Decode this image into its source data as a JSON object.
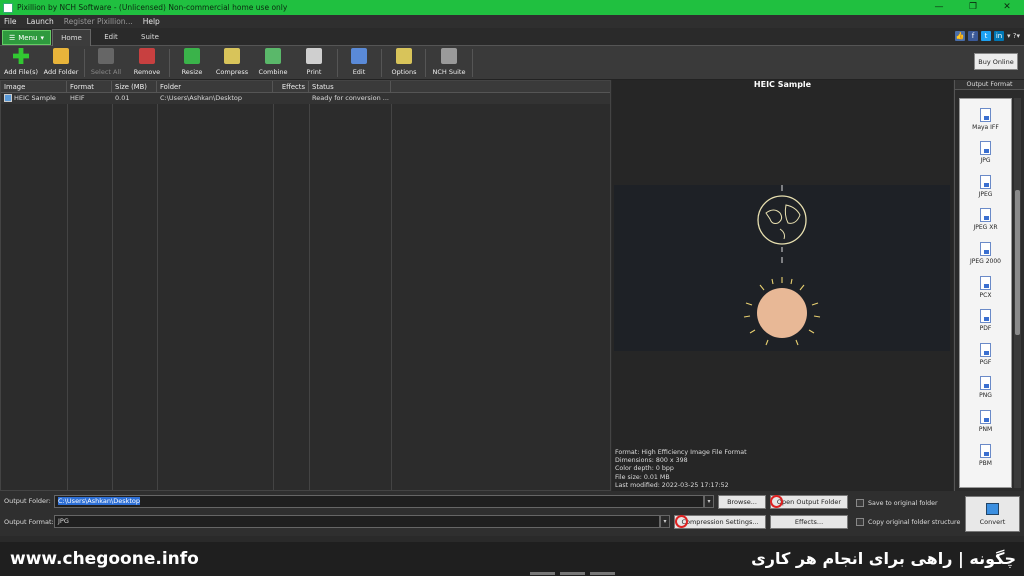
{
  "window": {
    "title": "Pixillion by NCH Software - (Unlicensed) Non-commercial home use only",
    "controls": [
      "—",
      "❐",
      "✕"
    ]
  },
  "menubar": {
    "items": [
      "File",
      "Launch",
      "Register Pixillion...",
      "Help"
    ]
  },
  "ribbon": {
    "menu_label": "Menu",
    "tabs": [
      "Home",
      "Edit",
      "Suite"
    ],
    "active_tab": "Home"
  },
  "toolbar": {
    "buttons": [
      {
        "label": "Add File(s)",
        "icon": "add-file-icon",
        "color": "#32c832"
      },
      {
        "label": "Add Folder",
        "icon": "add-folder-icon",
        "color": "#e8b43a"
      },
      {
        "label": "Select All",
        "icon": "select-all-icon",
        "color": "#777777",
        "disabled": true
      },
      {
        "label": "Remove",
        "icon": "remove-icon",
        "color": "#c84040"
      },
      {
        "label": "Resize",
        "icon": "resize-icon",
        "color": "#3ab34a"
      },
      {
        "label": "Compress",
        "icon": "compress-icon",
        "color": "#d8c45a"
      },
      {
        "label": "Combine",
        "icon": "combine-icon",
        "color": "#5ab86a"
      },
      {
        "label": "Print",
        "icon": "print-icon",
        "color": "#cfcfcf"
      },
      {
        "label": "Edit",
        "icon": "edit-icon",
        "color": "#5a8ad8"
      },
      {
        "label": "Options",
        "icon": "options-icon",
        "color": "#d8c45a"
      },
      {
        "label": "NCH Suite",
        "icon": "nch-suite-icon",
        "color": "#9a9a9a"
      }
    ],
    "buy_online": "Buy Online"
  },
  "file_list": {
    "columns": [
      "Image",
      "Format",
      "Size (MB)",
      "Folder",
      "Effects",
      "Status"
    ],
    "rows": [
      {
        "image": "HEIC Sample",
        "format": "HEIF",
        "size": "0.01",
        "folder": "C:\\Users\\Ashkan\\Desktop",
        "effects": "",
        "status": "Ready for conversion ..."
      }
    ]
  },
  "preview": {
    "title": "HEIC Sample",
    "info": [
      "Format: High Efficiency Image File Format",
      "Dimensions: 800 x 398",
      "Color depth: 0 bpp",
      "File size: 0.01 MB",
      "Last modified: 2022-03-25 17:17:52"
    ]
  },
  "output_format": {
    "header": "Output Format",
    "items": [
      "Maya IFF",
      "JPG",
      "JPEG",
      "JPEG XR",
      "JPEG 2000",
      "PCX",
      "PDF",
      "PGF",
      "PNG",
      "PNM",
      "PBM"
    ]
  },
  "bottom": {
    "output_folder_label": "Output Folder:",
    "output_folder_value": "C:\\Users\\Ashkan\\Desktop",
    "browse_label": "Browse...",
    "open_output_folder_label": "Open Output Folder",
    "output_format_label": "Output Format:",
    "output_format_value": "JPG",
    "compression_settings_label": "Compression Settings...",
    "effects_label": "Effects...",
    "save_to_original_label": "Save to original folder",
    "copy_structure_label": "Copy original folder structure",
    "convert_label": "Convert"
  },
  "watermark": {
    "left": "www.chegoone.info",
    "right": "چگونه | راهی برای انجام هر کاری"
  }
}
